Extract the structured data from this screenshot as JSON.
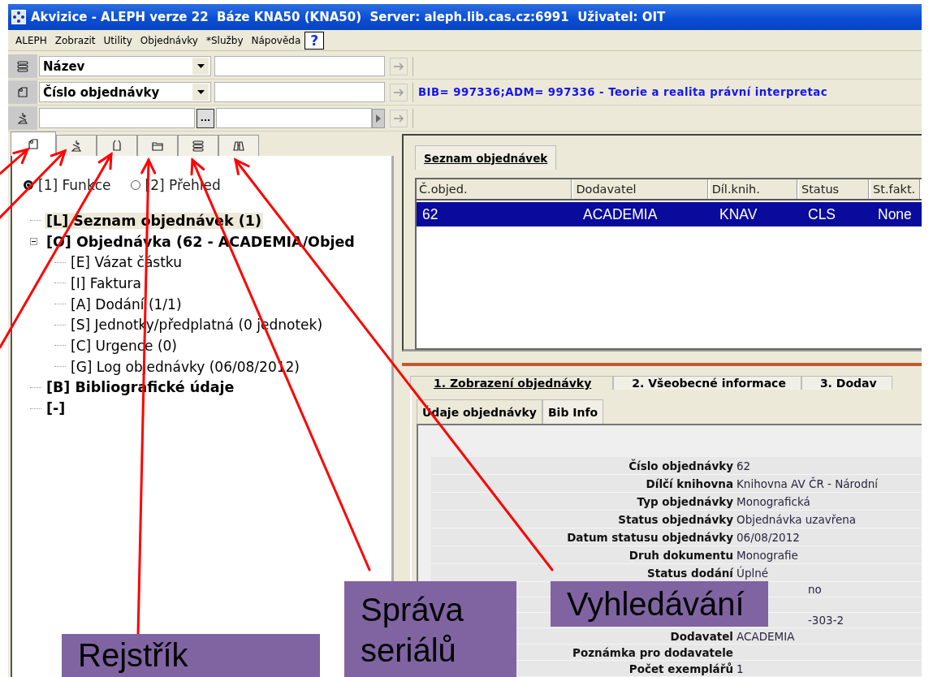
{
  "window": {
    "title": "Akvizice - ALEPH verze 22  Báze KNA50 (KNA50)  Server: aleph.lib.cas.cz:6991  Uživatel: OIT"
  },
  "menu": {
    "items": [
      "ALEPH",
      "Zobrazit",
      "Utility",
      "Objednávky",
      "*Služby",
      "Nápověda"
    ],
    "help": "?"
  },
  "search_rows": [
    {
      "kind": "dropdown",
      "field": "Název"
    },
    {
      "kind": "dropdown",
      "field": "Číslo objednávky",
      "info": "BIB= 997336;ADM= 997336 - Teorie a realita právní interpretac"
    },
    {
      "kind": "browse",
      "browse_button": "..."
    }
  ],
  "left_tabs": [
    {
      "selected": true
    },
    {
      "selected": false
    },
    {
      "selected": false
    },
    {
      "selected": false
    },
    {
      "selected": false
    },
    {
      "selected": false
    }
  ],
  "view_options": [
    {
      "label": "[1] Funkce",
      "selected": true
    },
    {
      "label": "[2] Přehled",
      "selected": false
    }
  ],
  "tree": [
    {
      "label": "[L] Seznam objednávek (1)",
      "selected": true
    },
    {
      "label": "[O] Objednávka (62 - ACADEMIA/Objed",
      "selected": false,
      "expanded": true,
      "children": [
        {
          "label": "[E] Vázat částku",
          "selected": false
        },
        {
          "label": "[I] Faktura",
          "selected": false
        },
        {
          "label": "[A] Dodání (1/1)",
          "selected": false
        },
        {
          "label": "[S] Jednotky/předplatná (0 jednotek)",
          "selected": false
        },
        {
          "label": "[C] Urgence (0)",
          "selected": false
        },
        {
          "label": "[G] Log objednávky (06/08/2012)",
          "selected": false
        }
      ]
    },
    {
      "label": "[B] Bibliografické údaje",
      "selected": false
    },
    {
      "label": "[-]",
      "selected": false
    }
  ],
  "order_list": {
    "tab": "Seznam objednávek",
    "columns": [
      "Č.objed.",
      "Dodavatel",
      "Díl.knih.",
      "Status",
      "St.fakt."
    ],
    "rows": [
      {
        "cells": [
          "62",
          "ACADEMIA",
          "KNAV",
          "CLS",
          "None"
        ],
        "selected": true
      }
    ]
  },
  "detail_tabs": [
    {
      "label": "1. Zobrazení objednávky",
      "selected": true
    },
    {
      "label": "2. Všeobecné informace",
      "selected": false
    },
    {
      "label": "3. Dodav",
      "selected": false
    }
  ],
  "detail_subtabs": [
    {
      "label": "Údaje objednávky",
      "selected": true
    },
    {
      "label": "Bib Info",
      "selected": false
    }
  ],
  "details": [
    {
      "kind": "full",
      "label": "Číslo objednávky",
      "value": "62"
    },
    {
      "kind": "full",
      "label": "Dílčí knihovna",
      "value": "Knihovna AV ČR - Národní"
    },
    {
      "kind": "full",
      "label": "Typ objednávky",
      "value": "Monografická"
    },
    {
      "kind": "full",
      "label": "Status objednávky",
      "value": "Objednávka uzavřena"
    },
    {
      "kind": "full",
      "label": "Datum statusu objednávky",
      "value": "06/08/2012"
    },
    {
      "kind": "full",
      "label": "Druh dokumentu",
      "value": "Monografie"
    },
    {
      "kind": "full",
      "label": "Status dodání",
      "value": "Úplné"
    },
    {
      "kind": "partial",
      "value": "no"
    },
    {
      "kind": "blank"
    },
    {
      "kind": "partial",
      "value": "-303-2"
    },
    {
      "kind": "full",
      "label": "Dodavatel",
      "value": "ACADEMIA"
    },
    {
      "kind": "full",
      "label": "Poznámka pro dodavatele"
    },
    {
      "kind": "full",
      "label": "Počet exemplářů",
      "value": "1"
    }
  ],
  "callouts": [
    "Rejstřík",
    "Správa seriálů",
    "Vyhledávání"
  ]
}
